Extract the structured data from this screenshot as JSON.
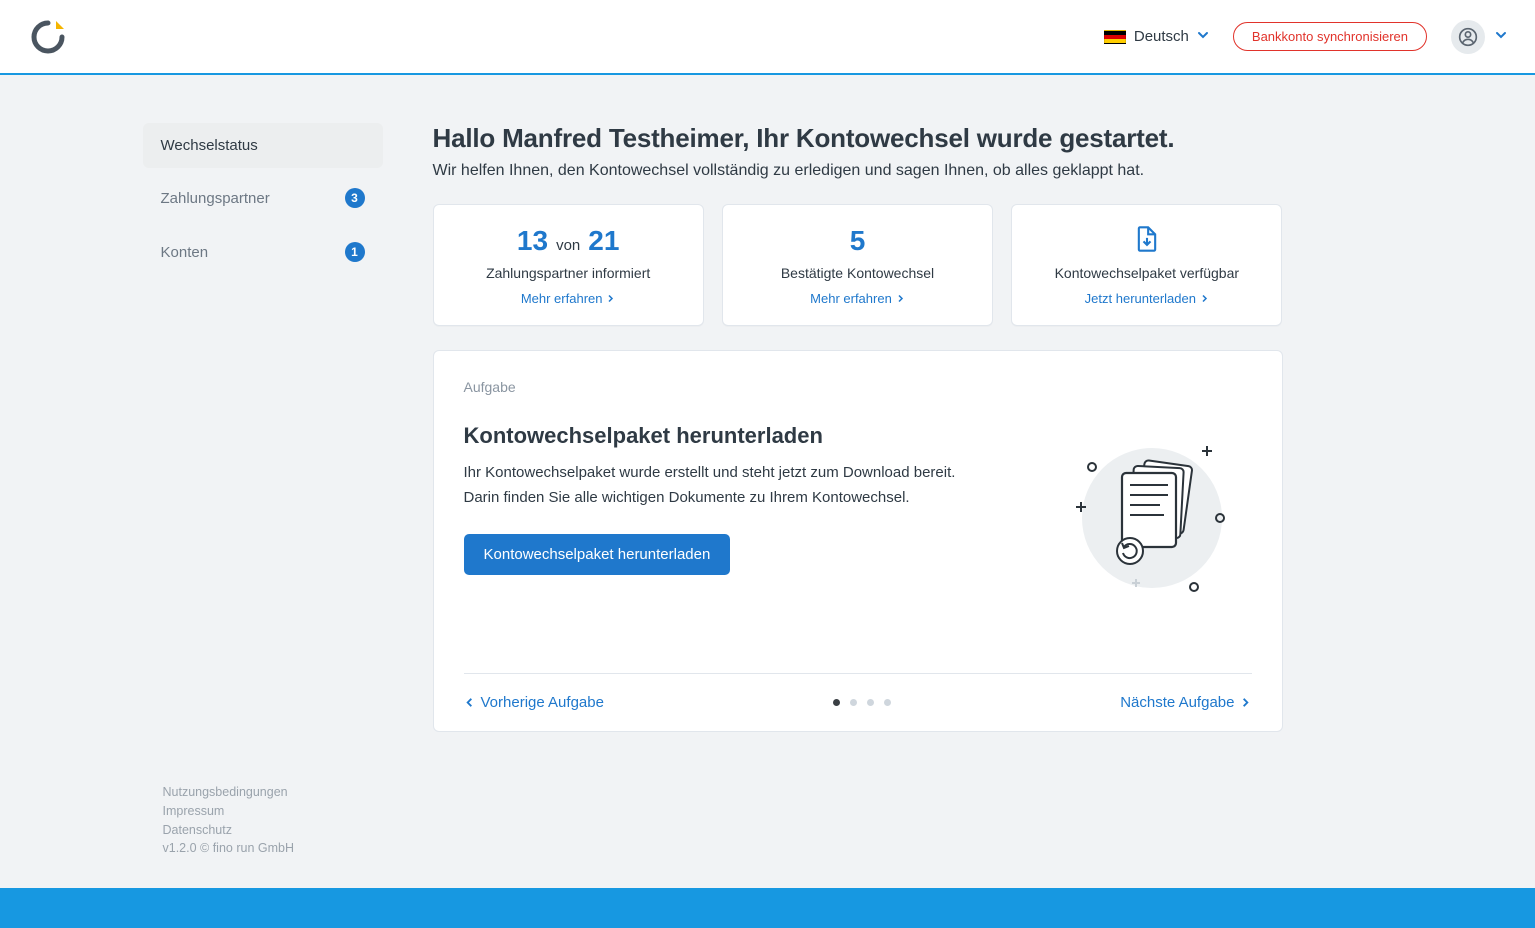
{
  "header": {
    "language_label": "Deutsch",
    "sync_button": "Bankkonto synchronisieren"
  },
  "sidebar": {
    "items": [
      {
        "label": "Wechselstatus",
        "badge": null
      },
      {
        "label": "Zahlungspartner",
        "badge": "3"
      },
      {
        "label": "Konten",
        "badge": "1"
      }
    ]
  },
  "page": {
    "title": "Hallo Manfred Testheimer, Ihr Kontowechsel wurde gestartet.",
    "subtitle": "Wir helfen Ihnen, den Kontowechsel vollständig zu erledigen und sagen Ihnen, ob alles geklappt hat."
  },
  "stats": {
    "card1": {
      "num_done": "13",
      "of_word": "von",
      "num_total": "21",
      "label": "Zahlungspartner informiert",
      "link": "Mehr erfahren"
    },
    "card2": {
      "num": "5",
      "label": "Bestätigte Kontowechsel",
      "link": "Mehr erfahren"
    },
    "card3": {
      "label": "Kontowechselpaket verfügbar",
      "link": "Jetzt herunterladen"
    }
  },
  "task": {
    "section_label": "Aufgabe",
    "title": "Kontowechselpaket herunterladen",
    "desc1": "Ihr Kontowechselpaket wurde erstellt und steht jetzt zum Download bereit.",
    "desc2": "Darin finden Sie alle wichtigen Dokumente zu Ihrem Kontowechsel.",
    "button": "Kontowechselpaket herunterladen",
    "prev": "Vorherige Aufgabe",
    "next": "Nächste Aufgabe"
  },
  "footer": {
    "terms": "Nutzungsbedingungen",
    "imprint": "Impressum",
    "privacy": "Datenschutz",
    "version": "v1.2.0 © fino run GmbH"
  }
}
